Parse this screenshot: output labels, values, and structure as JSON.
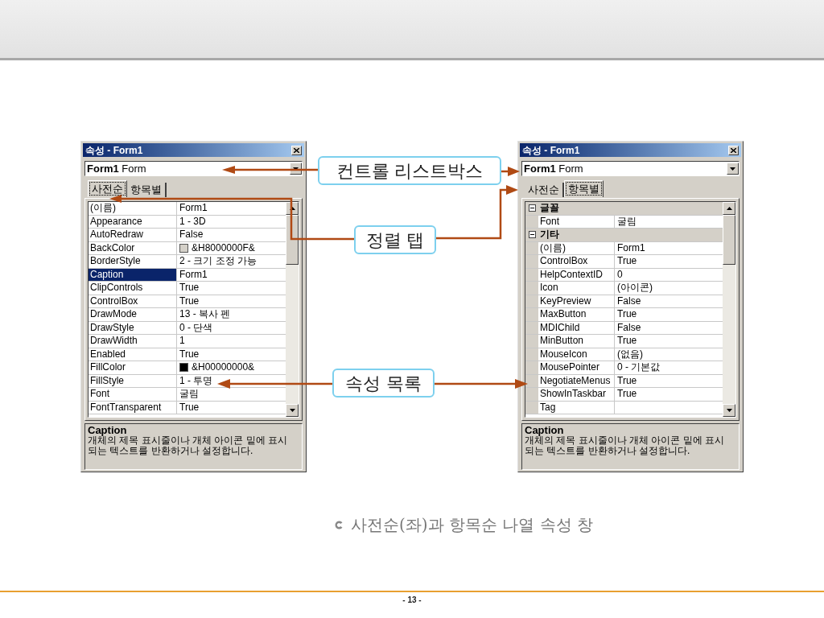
{
  "callouts": [
    {
      "label": "컨트롤 리스트박스"
    },
    {
      "label": "정렬 탭"
    },
    {
      "label": "속성 목록"
    }
  ],
  "windows": [
    {
      "title": "속성 - Form1",
      "object_name": "Form1",
      "object_type": "Form",
      "tabs": [
        {
          "label": "사전순",
          "selected": true
        },
        {
          "label": "항목별",
          "selected": false
        }
      ],
      "rows": [
        {
          "name": "(이름)",
          "value": "Form1",
          "selected": false
        },
        {
          "name": "Appearance",
          "value": "1 - 3D",
          "selected": false
        },
        {
          "name": "AutoRedraw",
          "value": "False",
          "selected": false
        },
        {
          "name": "BackColor",
          "value": "&H8000000F&",
          "color": "#d4d0c8",
          "selected": false
        },
        {
          "name": "BorderStyle",
          "value": "2 - 크기 조정 가능",
          "selected": false
        },
        {
          "name": "Caption",
          "value": "Form1",
          "selected": true
        },
        {
          "name": "ClipControls",
          "value": "True",
          "selected": false
        },
        {
          "name": "ControlBox",
          "value": "True",
          "selected": false
        },
        {
          "name": "DrawMode",
          "value": "13 - 복사 펜",
          "selected": false
        },
        {
          "name": "DrawStyle",
          "value": "0 - 단색",
          "selected": false
        },
        {
          "name": "DrawWidth",
          "value": "1",
          "selected": false
        },
        {
          "name": "Enabled",
          "value": "True",
          "selected": false
        },
        {
          "name": "FillColor",
          "value": "&H00000000&",
          "color": "#000000",
          "selected": false
        },
        {
          "name": "FillStyle",
          "value": "1 - 투명",
          "selected": false
        },
        {
          "name": "Font",
          "value": "굴림",
          "selected": false
        },
        {
          "name": "FontTransparent",
          "value": "True",
          "selected": false
        }
      ],
      "description": {
        "title": "Caption",
        "text": "개체의 제목 표시줄이나 개체 아이콘 밑에 표시되는 텍스트를 반환하거나 설정합니다."
      }
    },
    {
      "title": "속성 - Form1",
      "object_name": "Form1",
      "object_type": "Form",
      "tabs": [
        {
          "label": "사전순",
          "selected": false
        },
        {
          "label": "항목별",
          "selected": true
        }
      ],
      "rows": [
        {
          "kind": "category",
          "name": "글꼴",
          "expanded": true,
          "children": [
            {
              "kind": "property",
              "name": "Font",
              "value": "굴림"
            }
          ]
        },
        {
          "kind": "category",
          "name": "기타",
          "expanded": true,
          "children": [
            {
              "kind": "property",
              "name": "(이름)",
              "value": "Form1"
            },
            {
              "kind": "property",
              "name": "ControlBox",
              "value": "True"
            },
            {
              "kind": "property",
              "name": "HelpContextID",
              "value": "0"
            },
            {
              "kind": "property",
              "name": "Icon",
              "value": "(아이콘)"
            },
            {
              "kind": "property",
              "name": "KeyPreview",
              "value": "False"
            },
            {
              "kind": "property",
              "name": "MaxButton",
              "value": "True"
            },
            {
              "kind": "property",
              "name": "MDIChild",
              "value": "False"
            },
            {
              "kind": "property",
              "name": "MinButton",
              "value": "True"
            },
            {
              "kind": "property",
              "name": "MouseIcon",
              "value": "(없음)"
            },
            {
              "kind": "property",
              "name": "MousePointer",
              "value": "0 - 기본값"
            },
            {
              "kind": "property",
              "name": "NegotiateMenus",
              "value": "True"
            },
            {
              "kind": "property",
              "name": "ShowInTaskbar",
              "value": "True"
            },
            {
              "kind": "property",
              "name": "Tag"
            }
          ]
        }
      ],
      "description": {
        "title": "Caption",
        "text": "개체의 제목 표시줄이나 개체 아이콘 밑에 표시되는 텍스트를 반환하거나 설정합니다."
      }
    }
  ],
  "slide": {
    "caption": "사전순(좌)과 항목순 나열 속성 창",
    "page_number": "- 13 -"
  }
}
